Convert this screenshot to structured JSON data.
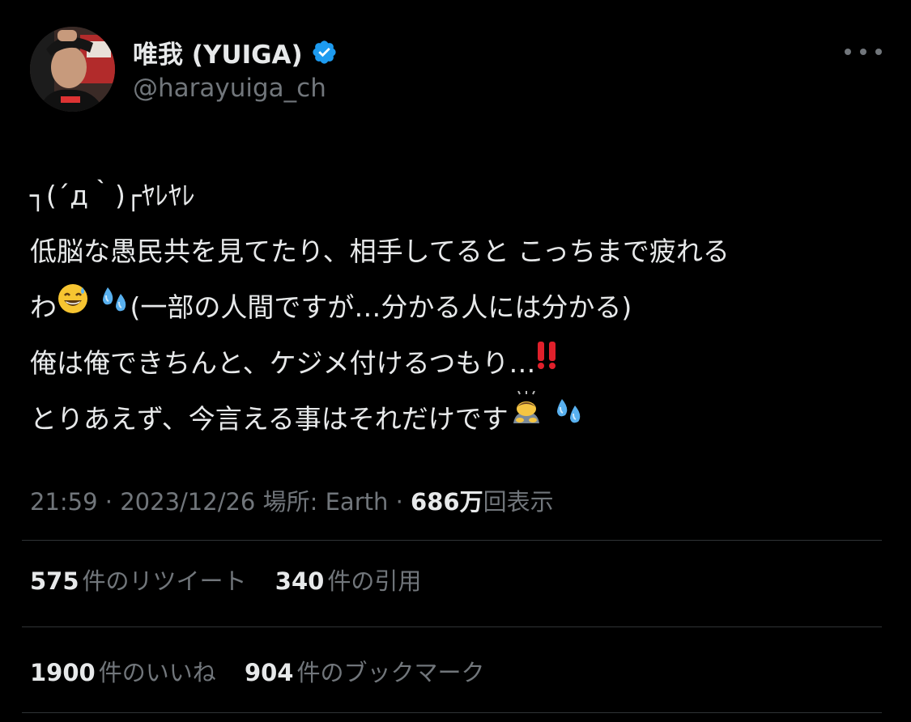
{
  "author": {
    "display_name": "唯我 (YUIGA)",
    "handle": "@harayuiga_ch",
    "verified": true,
    "verified_color": "#1d9bf0"
  },
  "more_icon": "more-horizontal-icon",
  "tweet": {
    "lines": [
      "┐(´д｀)┌ﾔﾚﾔﾚ",
      "低脳な愚民共を見てたり、相手してると こっちまで疲れる",
      "わ",
      "(一部の人間ですが…分かる人には分かる)",
      "俺は俺できちんと、ケジメ付けるつもり…",
      "とりあえず、今言える事はそれだけです"
    ],
    "emojis": {
      "sweat_smile": "grinning-sweat-icon",
      "droplets": "sweat-droplets-icon",
      "double_exclamation": "double-exclamation-icon",
      "bowing": "person-bowing-icon"
    }
  },
  "meta": {
    "time": "21:59",
    "separator": "·",
    "date": "2023/12/26",
    "location": "場所: Earth",
    "views_count": "686万",
    "views_label": "回表示"
  },
  "stats": {
    "retweets_count": "575",
    "retweets_label": "件のリツイート",
    "quotes_count": "340",
    "quotes_label": "件の引用",
    "likes_count": "1900",
    "likes_label": "件のいいね",
    "bookmarks_count": "904",
    "bookmarks_label": "件のブックマーク"
  },
  "colors": {
    "background": "#000000",
    "text": "#e7e9ea",
    "secondary": "#71767b",
    "divider": "#2f3336"
  }
}
